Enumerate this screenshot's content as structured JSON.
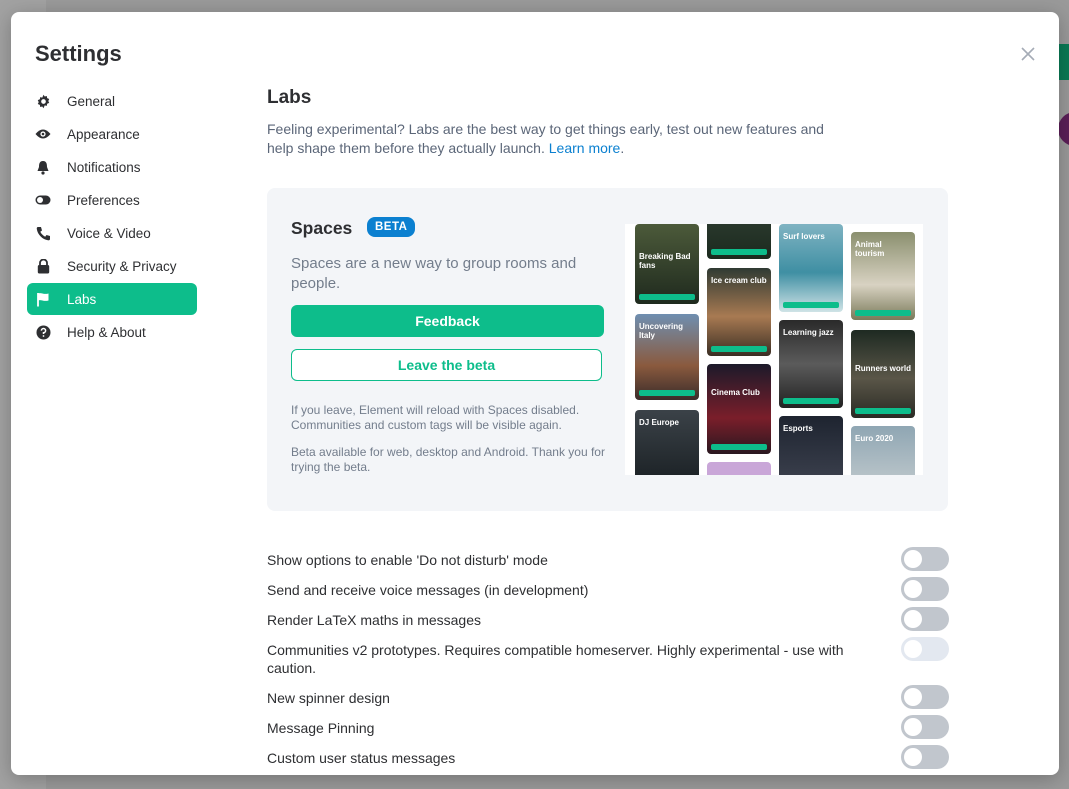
{
  "dialog": {
    "title": "Settings",
    "close_icon": "close-icon"
  },
  "sidebar": {
    "items": [
      {
        "label": "General",
        "icon": "gear-icon",
        "active": false
      },
      {
        "label": "Appearance",
        "icon": "eye-icon",
        "active": false
      },
      {
        "label": "Notifications",
        "icon": "bell-icon",
        "active": false
      },
      {
        "label": "Preferences",
        "icon": "toggle-icon",
        "active": false
      },
      {
        "label": "Voice & Video",
        "icon": "phone-icon",
        "active": false
      },
      {
        "label": "Security & Privacy",
        "icon": "lock-icon",
        "active": false
      },
      {
        "label": "Labs",
        "icon": "flag-icon",
        "active": true
      },
      {
        "label": "Help & About",
        "icon": "help-icon",
        "active": false
      }
    ],
    "active_color": "#0dbd8b"
  },
  "labs": {
    "title": "Labs",
    "description": "Feeling experimental? Labs are the best way to get things early, test out new features and help shape them before they actually launch.",
    "learn_more": "Learn more",
    "description_end": "."
  },
  "beta": {
    "title": "Spaces",
    "badge": "BETA",
    "caption": "Spaces are a new way to group rooms and people.",
    "feedback_label": "Feedback",
    "leave_label": "Leave the beta",
    "fine_print_1": "If you leave, Element will reload with Spaces disabled. Communities and custom tags will be visible again.",
    "fine_print_2": "Beta available for web, desktop and Android. Thank you for trying the beta.",
    "tiles": [
      "Breaking Bad fans",
      "Ice cream club",
      "Surf lovers",
      "Animal tourism",
      "Uncovering Italy",
      "Cinema Club",
      "Learning jazz",
      "Runners world",
      "DJ Europe",
      "Esports",
      "Euro 2020"
    ]
  },
  "settings": [
    {
      "label": "Show options to enable 'Do not disturb' mode",
      "enabled": false,
      "disabled": false
    },
    {
      "label": "Send and receive voice messages (in development)",
      "enabled": false,
      "disabled": false
    },
    {
      "label": "Render LaTeX maths in messages",
      "enabled": false,
      "disabled": false
    },
    {
      "label": "Communities v2 prototypes. Requires compatible homeserver. Highly experimental - use with caution.",
      "enabled": false,
      "disabled": true
    },
    {
      "label": "New spinner design",
      "enabled": false,
      "disabled": false
    },
    {
      "label": "Message Pinning",
      "enabled": false,
      "disabled": false
    },
    {
      "label": "Custom user status messages",
      "enabled": false,
      "disabled": false
    }
  ]
}
